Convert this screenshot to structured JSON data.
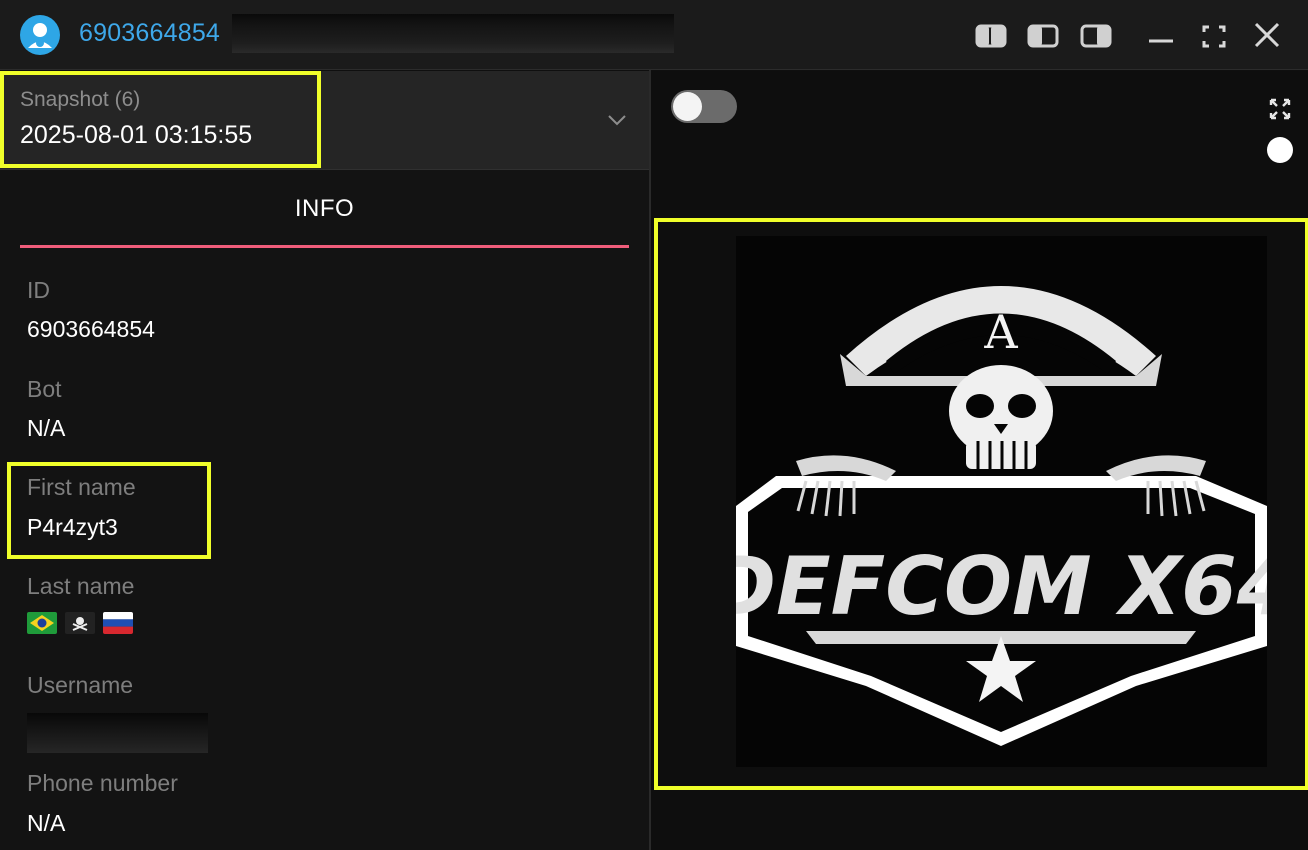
{
  "window": {
    "title_id": "6903664854",
    "controls": [
      "layout-left-icon",
      "layout-center-icon",
      "layout-right-icon",
      "minimize-icon",
      "maximize-icon",
      "close-icon"
    ]
  },
  "snapshot": {
    "label": "Snapshot (6)",
    "value": "2025-08-01 03:15:55"
  },
  "tabs": [
    {
      "label": "INFO",
      "active": true
    }
  ],
  "info": {
    "id_label": "ID",
    "id_value": "6903664854",
    "bot_label": "Bot",
    "bot_value": "N/A",
    "first_name_label": "First name",
    "first_name_value": "P4r4zyt3",
    "last_name_label": "Last name",
    "last_name_flags": [
      "flag-brazil-icon",
      "flag-pirate-icon",
      "flag-russia-icon"
    ],
    "username_label": "Username",
    "phone_label": "Phone number",
    "phone_value": "N/A"
  },
  "profile_image": {
    "logo_top_letter": "A",
    "logo_text": "DEFCOM X64"
  },
  "colors": {
    "accent_blue": "#3ea8ea",
    "tab_underline": "#ef5d7b",
    "highlight": "#f0ff2a"
  }
}
